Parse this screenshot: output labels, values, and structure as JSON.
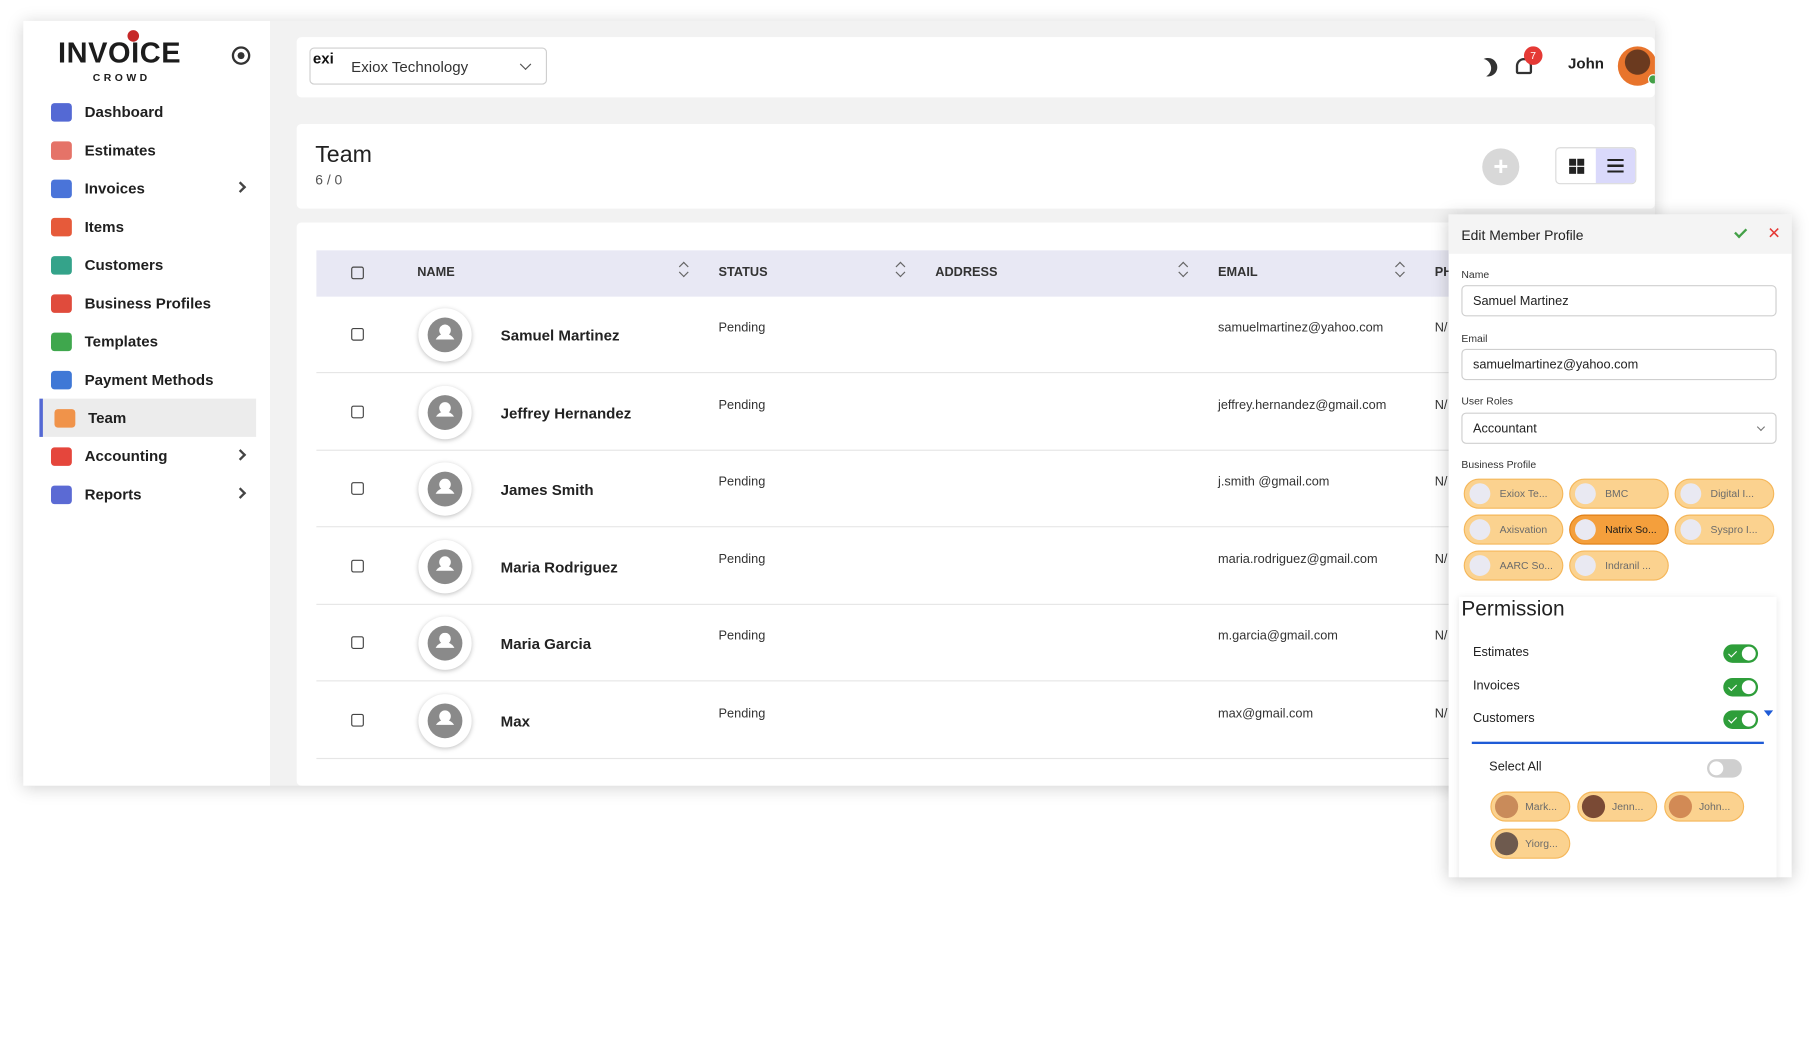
{
  "logo": {
    "main": "INVOICE",
    "sub": "CROWD"
  },
  "sidebar": {
    "items": [
      {
        "label": "Dashboard",
        "color": "#5469d4"
      },
      {
        "label": "Estimates",
        "color": "#e57368"
      },
      {
        "label": "Invoices",
        "color": "#4a74d9",
        "has_children": true
      },
      {
        "label": "Items",
        "color": "#e65a3a"
      },
      {
        "label": "Customers",
        "color": "#34a38a"
      },
      {
        "label": "Business Profiles",
        "color": "#e04b3c"
      },
      {
        "label": "Templates",
        "color": "#3fa74d"
      },
      {
        "label": "Payment Methods",
        "color": "#3f78d6"
      },
      {
        "label": "Team",
        "color": "#f0934a",
        "active": true
      },
      {
        "label": "Accounting",
        "color": "#e5463c",
        "has_children": true
      },
      {
        "label": "Reports",
        "color": "#5b6ad4",
        "has_children": true
      }
    ]
  },
  "topbar": {
    "company_logo_text": "exi",
    "company_name": "Exiox Technology",
    "notification_count": "7",
    "user_name": "John"
  },
  "header": {
    "title": "Team",
    "count": "6 / 0"
  },
  "table": {
    "columns": {
      "name": "NAME",
      "status": "STATUS",
      "address": "ADDRESS",
      "email": "EMAIL",
      "phone": "PH"
    },
    "rows": [
      {
        "name": "Samuel Martinez",
        "status": "Pending",
        "email": "samuelmartinez@yahoo.com",
        "phone": "N/"
      },
      {
        "name": "Jeffrey Hernandez",
        "status": "Pending",
        "email": "jeffrey.hernandez@gmail.com",
        "phone": "N/"
      },
      {
        "name": "James Smith",
        "status": "Pending",
        "email": "j.smith @gmail.com",
        "phone": "N/"
      },
      {
        "name": "Maria Rodriguez",
        "status": "Pending",
        "email": "maria.rodriguez@gmail.com",
        "phone": "N/"
      },
      {
        "name": "Maria Garcia",
        "status": "Pending",
        "email": "m.garcia@gmail.com",
        "phone": "N/"
      },
      {
        "name": "Max",
        "status": "Pending",
        "email": "max@gmail.com",
        "phone": "N/"
      }
    ]
  },
  "panel": {
    "title": "Edit Member Profile",
    "name_label": "Name",
    "name_value": "Samuel Martinez",
    "email_label": "Email",
    "email_value": "samuelmartinez@yahoo.com",
    "roles_label": "User Roles",
    "roles_value": "Accountant",
    "business_label": "Business Profile",
    "business_profiles": [
      {
        "label": "Exiox Te...",
        "selected": false
      },
      {
        "label": "BMC",
        "selected": false
      },
      {
        "label": "Digital I...",
        "selected": false
      },
      {
        "label": "Axisvation",
        "selected": false
      },
      {
        "label": "Natrix So...",
        "selected": true
      },
      {
        "label": "Syspro I...",
        "selected": false
      },
      {
        "label": "AARC So...",
        "selected": false
      },
      {
        "label": "Indranil ...",
        "selected": false
      }
    ],
    "permission_title": "Permission",
    "permissions": [
      {
        "label": "Estimates",
        "enabled": true
      },
      {
        "label": "Invoices",
        "enabled": true
      },
      {
        "label": "Customers",
        "enabled": true
      }
    ],
    "select_all_label": "Select All",
    "select_all_enabled": false,
    "customers": [
      {
        "label": "Mark...",
        "color": "#c98b5a"
      },
      {
        "label": "Jenn...",
        "color": "#7a4a35"
      },
      {
        "label": "John...",
        "color": "#d28a55"
      },
      {
        "label": "Yiorg...",
        "color": "#6e5a4e"
      }
    ]
  }
}
